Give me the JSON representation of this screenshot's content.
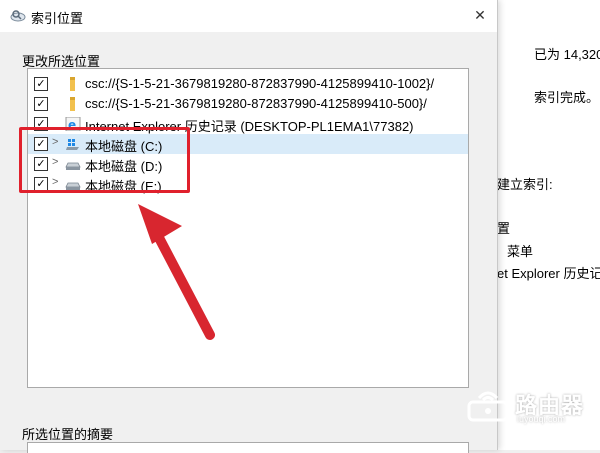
{
  "background_window": {
    "indexed_count": "已为 14,320",
    "status": "索引完成。",
    "build_index": "建立索引:",
    "item_1": "置",
    "item_2": "菜单",
    "item_3": "et Explorer 历史记"
  },
  "dialog": {
    "title": "索引位置",
    "close_symbol": "✕",
    "change_locations_label": "更改所选位置",
    "summary_label": "所选位置的摘要",
    "tree_items": [
      {
        "label": "csc://{S-1-5-21-3679819280-872837990-4125899410-1002}/",
        "checked": true,
        "expander": "",
        "icon": "folder-icon"
      },
      {
        "label": "csc://{S-1-5-21-3679819280-872837990-4125899410-500}/",
        "checked": true,
        "expander": "",
        "icon": "folder-icon"
      },
      {
        "label": "Internet Explorer 历史记录 (DESKTOP-PL1EMA1\\77382)",
        "checked": true,
        "expander": "",
        "icon": "internet-explorer-icon"
      },
      {
        "label": "本地磁盘 (C:)",
        "checked": true,
        "expander": ">",
        "icon": "windows-drive-icon",
        "selected": true
      },
      {
        "label": "本地磁盘 (D:)",
        "checked": true,
        "expander": ">",
        "icon": "drive-icon"
      },
      {
        "label": "本地磁盘 (E:)",
        "checked": true,
        "expander": ">",
        "icon": "drive-icon"
      }
    ]
  },
  "watermark": {
    "text": "路由器",
    "sub": "luyouqi.com"
  },
  "colors": {
    "highlight": "#e0202c",
    "selected_row": "#d9ebf9",
    "folder": "#f2c14e"
  }
}
